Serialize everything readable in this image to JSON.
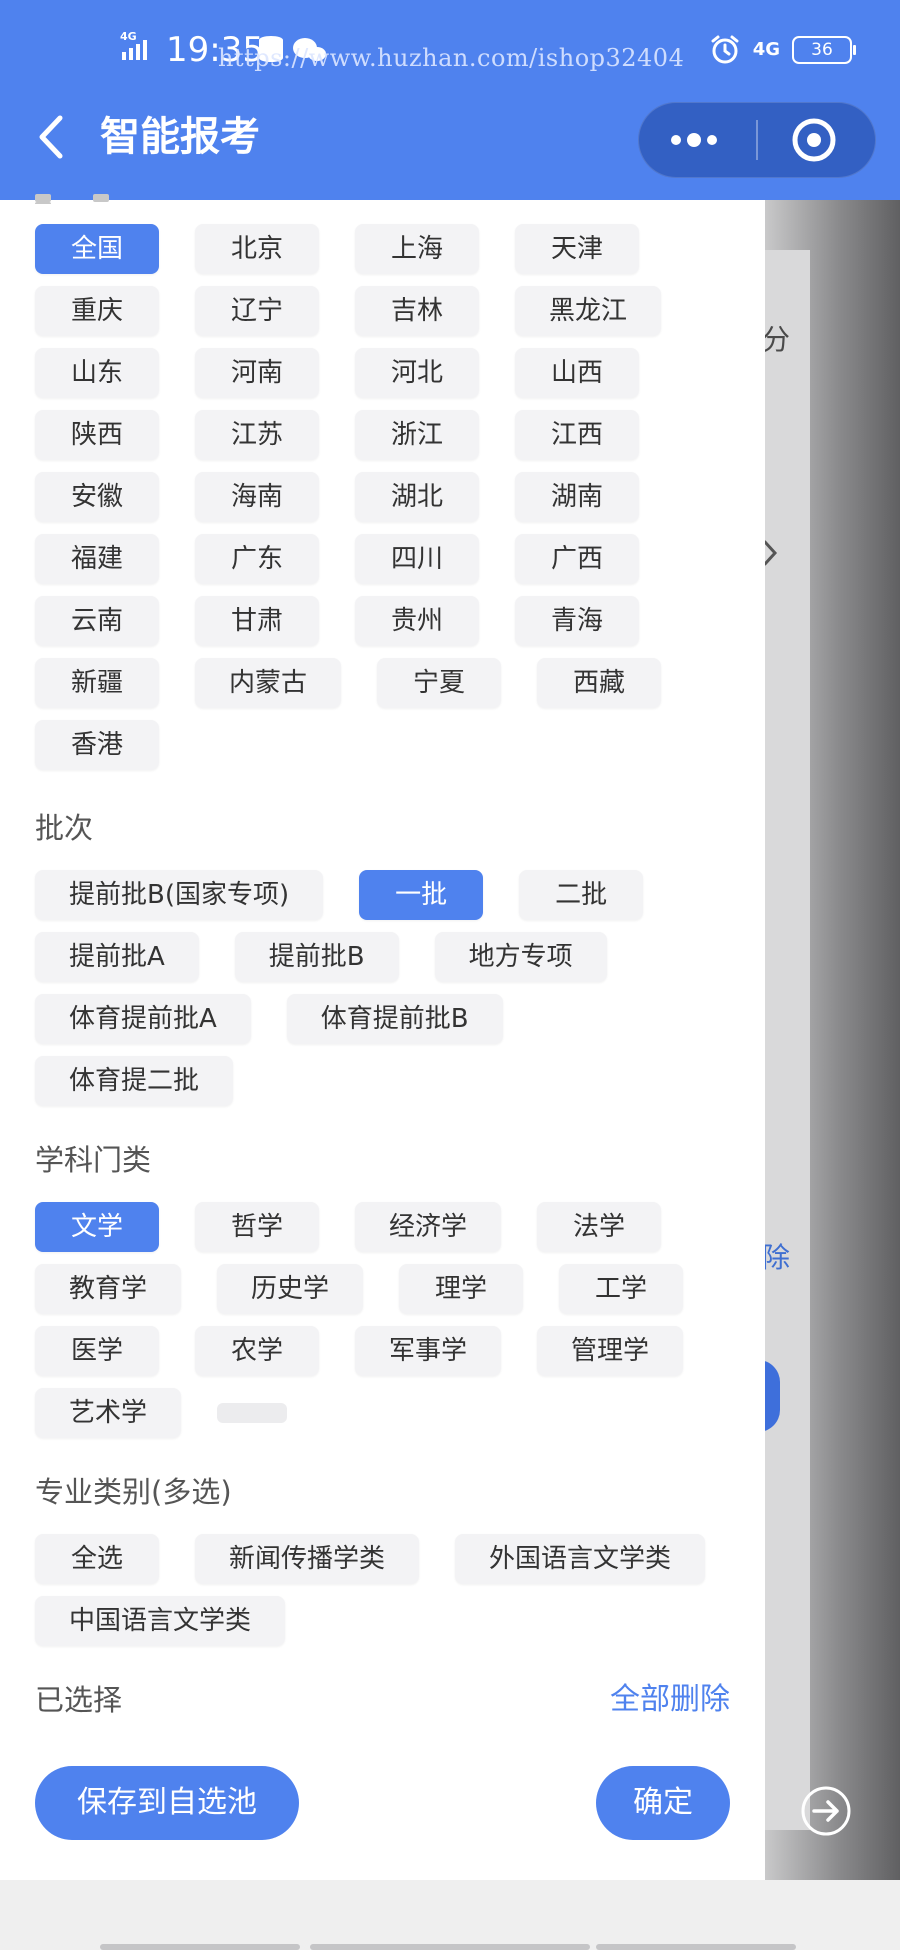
{
  "status_bar": {
    "network": "4G",
    "time": "19:35",
    "watermark": "https://www.huzhan.com/ishop32404",
    "network_right": "4G",
    "battery": "36"
  },
  "header": {
    "title": "智能报考"
  },
  "regions": {
    "items": [
      "全国",
      "北京",
      "上海",
      "天津",
      "重庆",
      "辽宁",
      "吉林",
      "黑龙江",
      "山东",
      "河南",
      "河北",
      "山西",
      "陕西",
      "江苏",
      "浙江",
      "江西",
      "安徽",
      "海南",
      "湖北",
      "湖南",
      "福建",
      "广东",
      "四川",
      "广西",
      "云南",
      "甘肃",
      "贵州",
      "青海",
      "新疆",
      "内蒙古",
      "宁夏",
      "西藏",
      "香港"
    ],
    "selected": "全国"
  },
  "batch": {
    "title": "批次",
    "items": [
      "提前批B(国家专项)",
      "一批",
      "二批",
      "提前批A",
      "提前批B",
      "地方专项",
      "体育提前批A",
      "体育提前批B",
      "体育提二批"
    ],
    "selected": "一批"
  },
  "discipline": {
    "title": "学科门类",
    "items": [
      "文学",
      "哲学",
      "经济学",
      "法学",
      "教育学",
      "历史学",
      "理学",
      "工学",
      "医学",
      "农学",
      "军事学",
      "管理学",
      "艺术学"
    ],
    "selected": "文学"
  },
  "major_category": {
    "title": "专业类别(多选)",
    "items": [
      "全选",
      "新闻传播学类",
      "外国语言文学类",
      "中国语言文学类"
    ]
  },
  "selected_section": {
    "title": "已选择",
    "clear_all": "全部删除"
  },
  "actions": {
    "save_label": "保存到自选池",
    "confirm_label": "确定"
  },
  "background_page": {
    "fen": "分",
    "chu": "除"
  },
  "colors": {
    "primary": "#4f82ee",
    "chip_bg": "#f3f3f5",
    "chip_text": "#333333"
  }
}
